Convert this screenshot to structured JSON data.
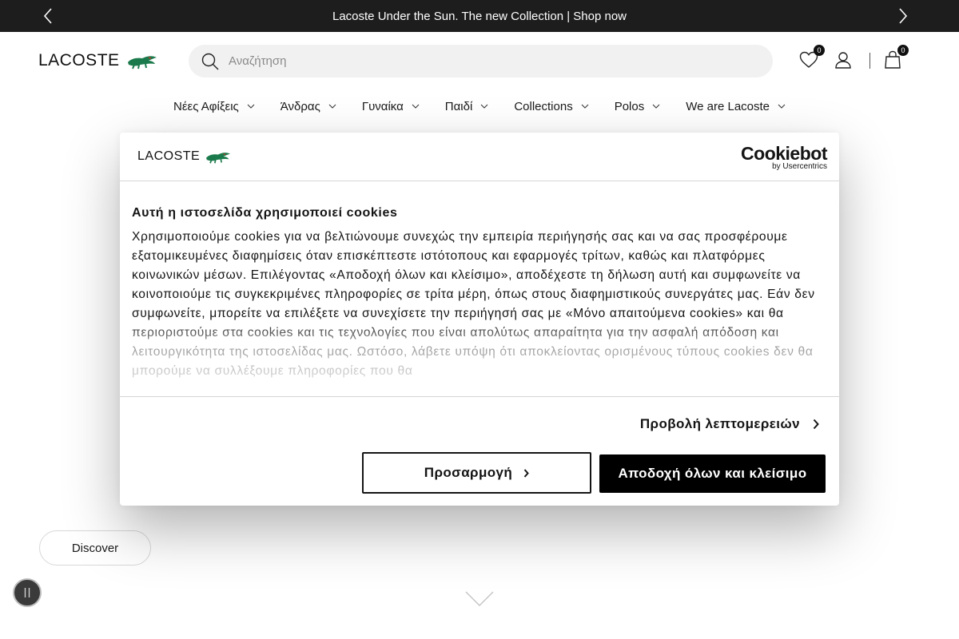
{
  "announcement": {
    "text": "Lacoste Under the Sun. The new Collection | Shop now"
  },
  "header": {
    "logo_text": "LACOSTE",
    "search_placeholder": "Αναζήτηση",
    "wishlist_count": "0",
    "cart_count": "0"
  },
  "nav": {
    "items": [
      {
        "label": "Νέες Αφίξεις"
      },
      {
        "label": "Άνδρας"
      },
      {
        "label": "Γυναίκα"
      },
      {
        "label": "Παιδί"
      },
      {
        "label": "Collections"
      },
      {
        "label": "Polos"
      },
      {
        "label": "We are Lacoste"
      }
    ]
  },
  "hero": {
    "discover_label": "Discover"
  },
  "cookie": {
    "logo_text": "LACOSTE",
    "brand": "Cookiebot",
    "brand_sub": "by Usercentrics",
    "title": "Αυτή η ιστοσελίδα χρησιμοποιεί cookies",
    "text": "Χρησιμοποιούμε cookies για να βελτιώνουμε συνεχώς την εμπειρία περιήγησής σας και να σας προσφέρουμε εξατομικευμένες διαφημίσεις όταν επισκέπτεστε ιστότοπους και εφαρμογές τρίτων, καθώς και πλατφόρμες κοινωνικών μέσων. Επιλέγοντας «Αποδοχή όλων και κλείσιμο», αποδέχεστε τη δήλωση αυτή και συμφωνείτε να κοινοποιούμε τις συγκεκριμένες πληροφορίες σε τρίτα μέρη, όπως στους διαφημιστικούς συνεργάτες μας. Εάν δεν συμφωνείτε, μπορείτε να επιλέξετε να συνεχίσετε την περιήγησή σας με «Μόνο απαιτούμενα cookies» και θα περιοριστούμε στα cookies και τις τεχνολογίες που είναι απολύτως απαραίτητα για την ασφαλή απόδοση και λειτουργικότητα της ιστοσελίδας μας. Ωστόσο, λάβετε υπόψη ότι αποκλείοντας ορισμένους τύπους cookies δεν θα μπορούμε να συλλέξουμε πληροφορίες που θα",
    "details_label": "Προβολή λεπτομερειών",
    "customize_label": "Προσαρμογή",
    "accept_label": "Αποδοχή όλων και κλείσιμο"
  },
  "colors": {
    "announcement_bg": "#1d1d1d",
    "brand_green": "#1b7a4b",
    "accept_bg": "#000000"
  }
}
